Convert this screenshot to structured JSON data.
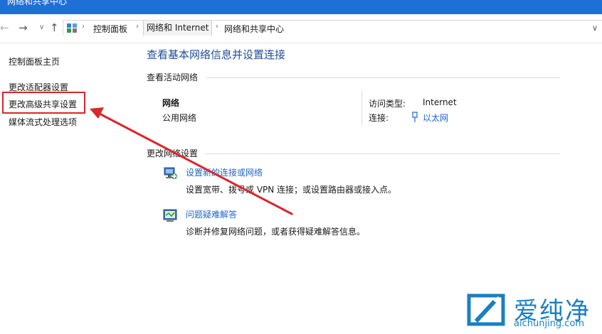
{
  "window": {
    "title": "网络和共享中心"
  },
  "addressbar": {
    "back_icon": "←",
    "forward_icon": "→",
    "dropdown_icon": "∨",
    "up_icon": "↑",
    "crumbs": [
      "控制面板",
      "网络和 Internet",
      "网络和共享中心"
    ],
    "sep": "›",
    "expand_icon": "∨"
  },
  "sidebar": {
    "home": "控制面板主页",
    "items": [
      "更改适配器设置",
      "更改高级共享设置",
      "媒体流式处理选项"
    ]
  },
  "main": {
    "title": "查看基本网络信息并设置连接",
    "active_header": "查看活动网络",
    "network": {
      "name": "网络",
      "type": "公用网络",
      "access_label": "访问类型:",
      "access_value": "Internet",
      "conn_label": "连接:",
      "conn_value": "以太网"
    },
    "change_header": "更改网络设置",
    "tasks": [
      {
        "link": "设置新的连接或网络",
        "desc": "设置宽带、拨号或 VPN 连接；或设置路由器或接入点。"
      },
      {
        "link": "问题疑难解答",
        "desc": "诊断并修复网络问题，或者获得疑难解答信息。"
      }
    ]
  },
  "watermark": {
    "text": "爱纯净",
    "url": "aichunjing.com"
  },
  "colors": {
    "titlebar": "#1f6fd6",
    "link": "#1f66c8",
    "heading": "#1f4e9c",
    "annotation": "#d9262b",
    "watermark": "#1a7fc2"
  }
}
